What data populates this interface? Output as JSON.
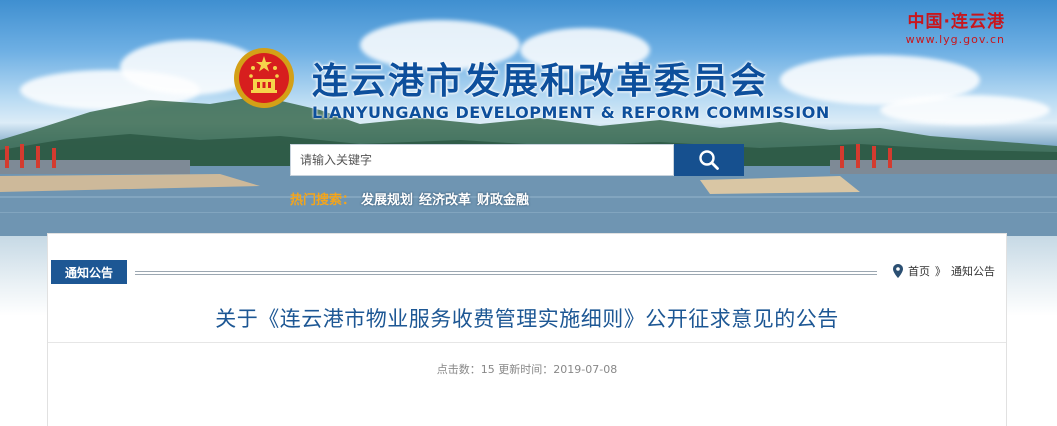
{
  "header": {
    "site_name": "中国·连云港",
    "site_url": "www.lyg.gov.cn",
    "title_cn": "连云港市发展和改革委员会",
    "title_en": "LIANYUNGANG DEVELOPMENT & REFORM COMMISSION",
    "emblem_icon": "national-emblem-icon"
  },
  "search": {
    "placeholder": "请输入关键字",
    "value": "",
    "button_icon": "search-icon"
  },
  "hot_search": {
    "label": "热门搜索：",
    "items": [
      "发展规划",
      "经济改革",
      "财政金融"
    ]
  },
  "section": {
    "tab_label": "通知公告",
    "breadcrumb": {
      "icon": "location-pin-icon",
      "home": "首页",
      "separator": "》",
      "current": "通知公告"
    }
  },
  "article": {
    "title": "关于《连云港市物业服务收费管理实施细则》公开征求意见的公告",
    "meta": "点击数：15 更新时间：2019-07-08"
  },
  "colors": {
    "brand_blue": "#1d5794",
    "site_red": "#c8161d",
    "hot_label": "#f3a51c"
  }
}
